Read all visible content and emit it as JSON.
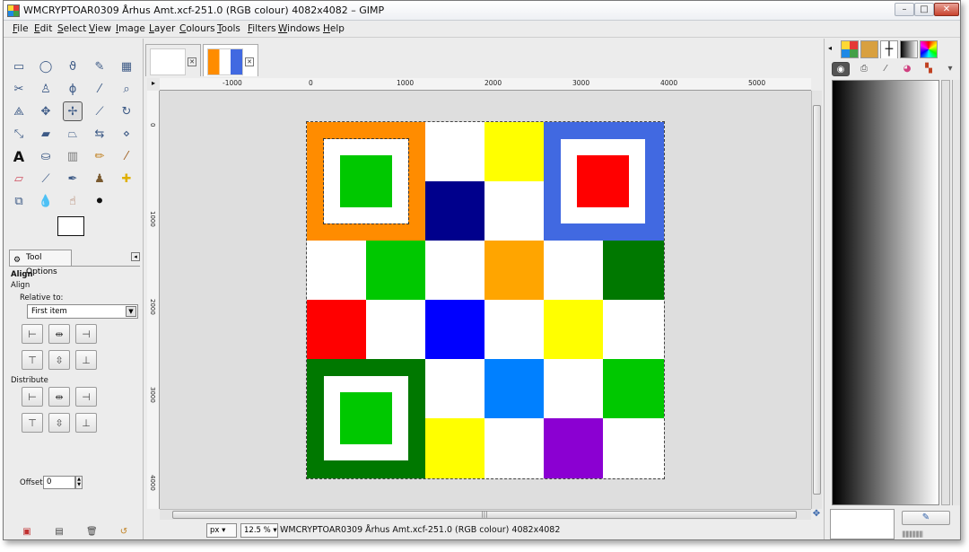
{
  "window": {
    "title": "WMCRYPTOAR0309 Århus Amt.xcf-251.0 (RGB colour) 4082x4082 – GIMP",
    "min_label": "–",
    "max_label": "□",
    "close_label": "✕"
  },
  "menubar": [
    "File",
    "Edit",
    "Select",
    "View",
    "Image",
    "Layer",
    "Colours",
    "Tools",
    "Filters",
    "Windows",
    "Help"
  ],
  "toolbox": {
    "tool_options_tab": "Tool Options",
    "align_title": "Align",
    "align_sub": "Align",
    "relative_to_label": "Relative to:",
    "relative_to_value": "First item",
    "distribute_label": "Distribute",
    "offset_label": "Offset:",
    "offset_value": "0"
  },
  "rulers": {
    "h_labels": [
      "-1000",
      "0",
      "1000",
      "2000",
      "3000",
      "4000",
      "5000"
    ],
    "v_labels": [
      "0",
      "1000",
      "2000",
      "3000",
      "4000"
    ]
  },
  "statusbar": {
    "unit": "px",
    "zoom": "12.5 %",
    "text": "WMCRYPTOAR0309 Århus Amt.xcf-251.0 (RGB colour) 4082x4082"
  },
  "colors": {
    "orange": "#ff8c00",
    "green": "#00c800",
    "dark_green": "#007800",
    "yellow": "#ffff00",
    "navy": "#00008c",
    "blue": "#0000ff",
    "royal_blue": "#4169e1",
    "red": "#ff0000",
    "light_orange": "#ffa500",
    "azure": "#0080ff",
    "purple": "#8b00d2",
    "white": "#ffffff"
  }
}
